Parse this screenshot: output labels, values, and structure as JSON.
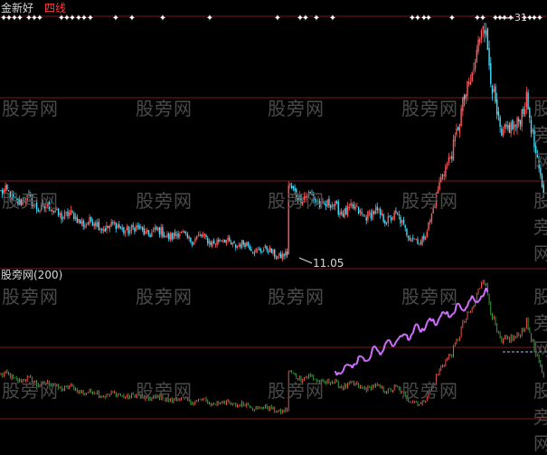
{
  "colors": {
    "background": "#000000",
    "up_candle": "#ff5b5b",
    "down_candle": "#40e0ff",
    "grid": "#7a1a1a",
    "signal": "#ffffff",
    "lower_up": "#ff5b5b",
    "lower_down": "#3fae3f",
    "lower_highlight": "#d070ff",
    "dashed_level": "#b8b8ff",
    "label_white": "#d8d8d8",
    "label_red": "#ff3a3a",
    "watermark": "#4a4a4a"
  },
  "upper_panel": {
    "title_part1": "金新好",
    "title_part2": "四线",
    "high_price_label": "31",
    "low_price_label": "11.05"
  },
  "lower_panel": {
    "title": "股旁网(200)"
  },
  "watermark_text": "股旁网",
  "chart_data": [
    {
      "type": "candlestick",
      "title": "金新好 四线",
      "price_labels": {
        "low": 11.05,
        "high": 31
      },
      "trend_segments": [
        {
          "from_bar": 0,
          "to_bar": 60,
          "start": 16.5,
          "end": 13.8
        },
        {
          "from_bar": 60,
          "to_bar": 150,
          "start": 13.8,
          "end": 12.2
        },
        {
          "from_bar": 150,
          "to_bar": 185,
          "start": 12.2,
          "end": 11.05
        },
        {
          "from_bar": 185,
          "to_bar": 215,
          "start": 16.8,
          "end": 15.2
        },
        {
          "from_bar": 215,
          "to_bar": 255,
          "start": 15.2,
          "end": 14.3
        },
        {
          "from_bar": 255,
          "to_bar": 270,
          "start": 14.3,
          "end": 11.9
        },
        {
          "from_bar": 270,
          "to_bar": 295,
          "start": 11.9,
          "end": 22.5
        },
        {
          "from_bar": 295,
          "to_bar": 310,
          "start": 22.5,
          "end": 31.0
        },
        {
          "from_bar": 310,
          "to_bar": 322,
          "start": 31.0,
          "end": 21.0
        },
        {
          "from_bar": 322,
          "to_bar": 338,
          "start": 21.0,
          "end": 24.0
        },
        {
          "from_bar": 338,
          "to_bar": 350,
          "start": 24.0,
          "end": 16.0
        }
      ],
      "signal_markers": "white star/plus glyphs along the top edge"
    },
    {
      "type": "line",
      "title": "股旁网(200)",
      "series_note": "oscillator with highlighted (purple) rising segment and a dashed horizontal level at the right"
    }
  ]
}
